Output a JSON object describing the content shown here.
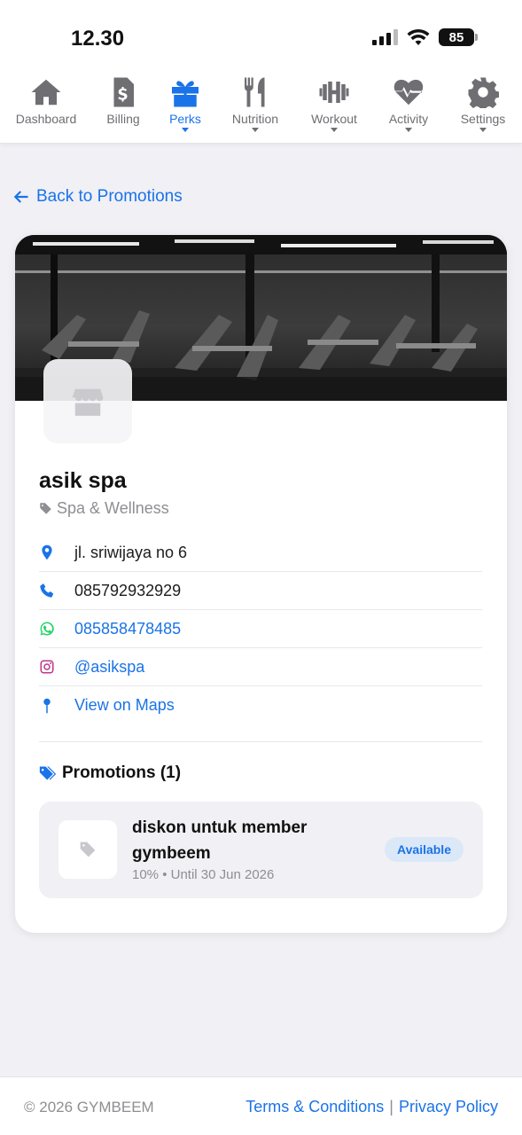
{
  "status_bar": {
    "time": "12.30",
    "battery": "85"
  },
  "nav": {
    "items": [
      {
        "label": "Dashboard",
        "icon": "home-icon",
        "active": false,
        "dropdown": false
      },
      {
        "label": "Billing",
        "icon": "billing-icon",
        "active": false,
        "dropdown": false
      },
      {
        "label": "Perks",
        "icon": "gift-icon",
        "active": true,
        "dropdown": true
      },
      {
        "label": "Nutrition",
        "icon": "utensils-icon",
        "active": false,
        "dropdown": true
      },
      {
        "label": "Workout",
        "icon": "dumbbell-icon",
        "active": false,
        "dropdown": true
      },
      {
        "label": "Activity",
        "icon": "heart-pulse-icon",
        "active": false,
        "dropdown": true
      },
      {
        "label": "Settings",
        "icon": "gear-icon",
        "active": false,
        "dropdown": true
      }
    ]
  },
  "back_link": {
    "label": "Back to Promotions"
  },
  "business": {
    "cover_image": "gym-interior-photo",
    "name": "asik spa",
    "category": "Spa & Wellness",
    "address": "jl. sriwijaya no 6",
    "phone": "085792932929",
    "whatsapp": "085858478485",
    "instagram": "@asikspa",
    "maps_label": "View on Maps"
  },
  "promotions": {
    "heading": "Promotions (1)",
    "items": [
      {
        "title": "diskon untuk member gymbeem",
        "meta": "10% • Until 30 Jun 2026",
        "badge": "Available"
      }
    ]
  },
  "footer": {
    "copyright": "© 2026 GYMBEEM",
    "terms": "Terms & Conditions",
    "separator": "|",
    "privacy": "Privacy Policy"
  },
  "colors": {
    "accent": "#1a73e8",
    "whatsapp": "#25d366",
    "instagram": "#c13584",
    "muted": "#8e8e93"
  }
}
